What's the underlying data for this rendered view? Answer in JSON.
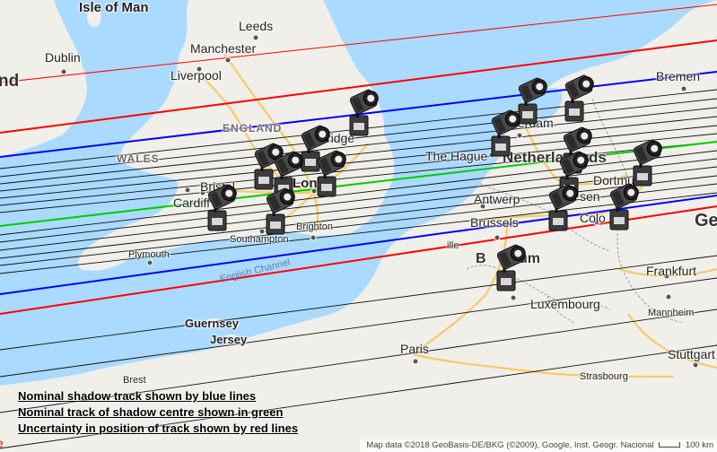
{
  "map": {
    "labels": {
      "isle_of_man": "Isle of Man",
      "leeds": "Leeds",
      "dublin": "Dublin",
      "manchester": "Manchester",
      "liverpool": "Liverpool",
      "ireland_partial": "nd",
      "england": "ENGLAND",
      "wales": "WALES",
      "bristol": "Bristol",
      "cardiff": "Cardiff",
      "london_partial": "Lon",
      "cambridge_partial": "ridge",
      "southampton": "Southampton",
      "brighton": "Brighton",
      "plymouth": "Plymouth",
      "english_channel": "English Channel",
      "guernsey": "Guernsey",
      "jersey": "Jersey",
      "brest": "Brest",
      "paris": "Paris",
      "strasbourg": "Strasbourg",
      "stuttgart": "Stuttgart",
      "mannheim": "Mannheim",
      "frankfurt": "Frankfurt",
      "luxembourg": "Luxembourg",
      "belgium_partial": "B",
      "belgium_partial2": "um",
      "liege_partial": "ille",
      "brussels": "Brussels",
      "antwerp": "Antwerp",
      "the_hague": "The Hague",
      "netherlands": "Netherlands",
      "netherlands_tail": "ds",
      "amsterdam_partial": "erdam",
      "bremen": "Bremen",
      "dortmund": "Dortmund",
      "essen_partial": "sen",
      "cologne_partial": "Colo",
      "germany_partial": "Ge"
    },
    "legend": {
      "blue": "Nominal shadow track shown by blue lines",
      "green": "Nominal track of shadow centre shown in green",
      "red": "Uncertainty in position of track shown by red lines"
    },
    "attribution": {
      "data": "Map data ©2018 GeoBasis-DE/BKG (©2009), Google, Inst. Geogr. Nacional",
      "scale": "100 km",
      "logo": "e"
    },
    "colors": {
      "sea": "#aadaff",
      "land": "#f1efe9",
      "blue_track": "#0000ff",
      "green_track": "#00dd00",
      "red_track": "#ff0000",
      "motorway": "#f8c967",
      "border": "#9e9e9e"
    },
    "observer_icons": "spotlight-icon"
  }
}
